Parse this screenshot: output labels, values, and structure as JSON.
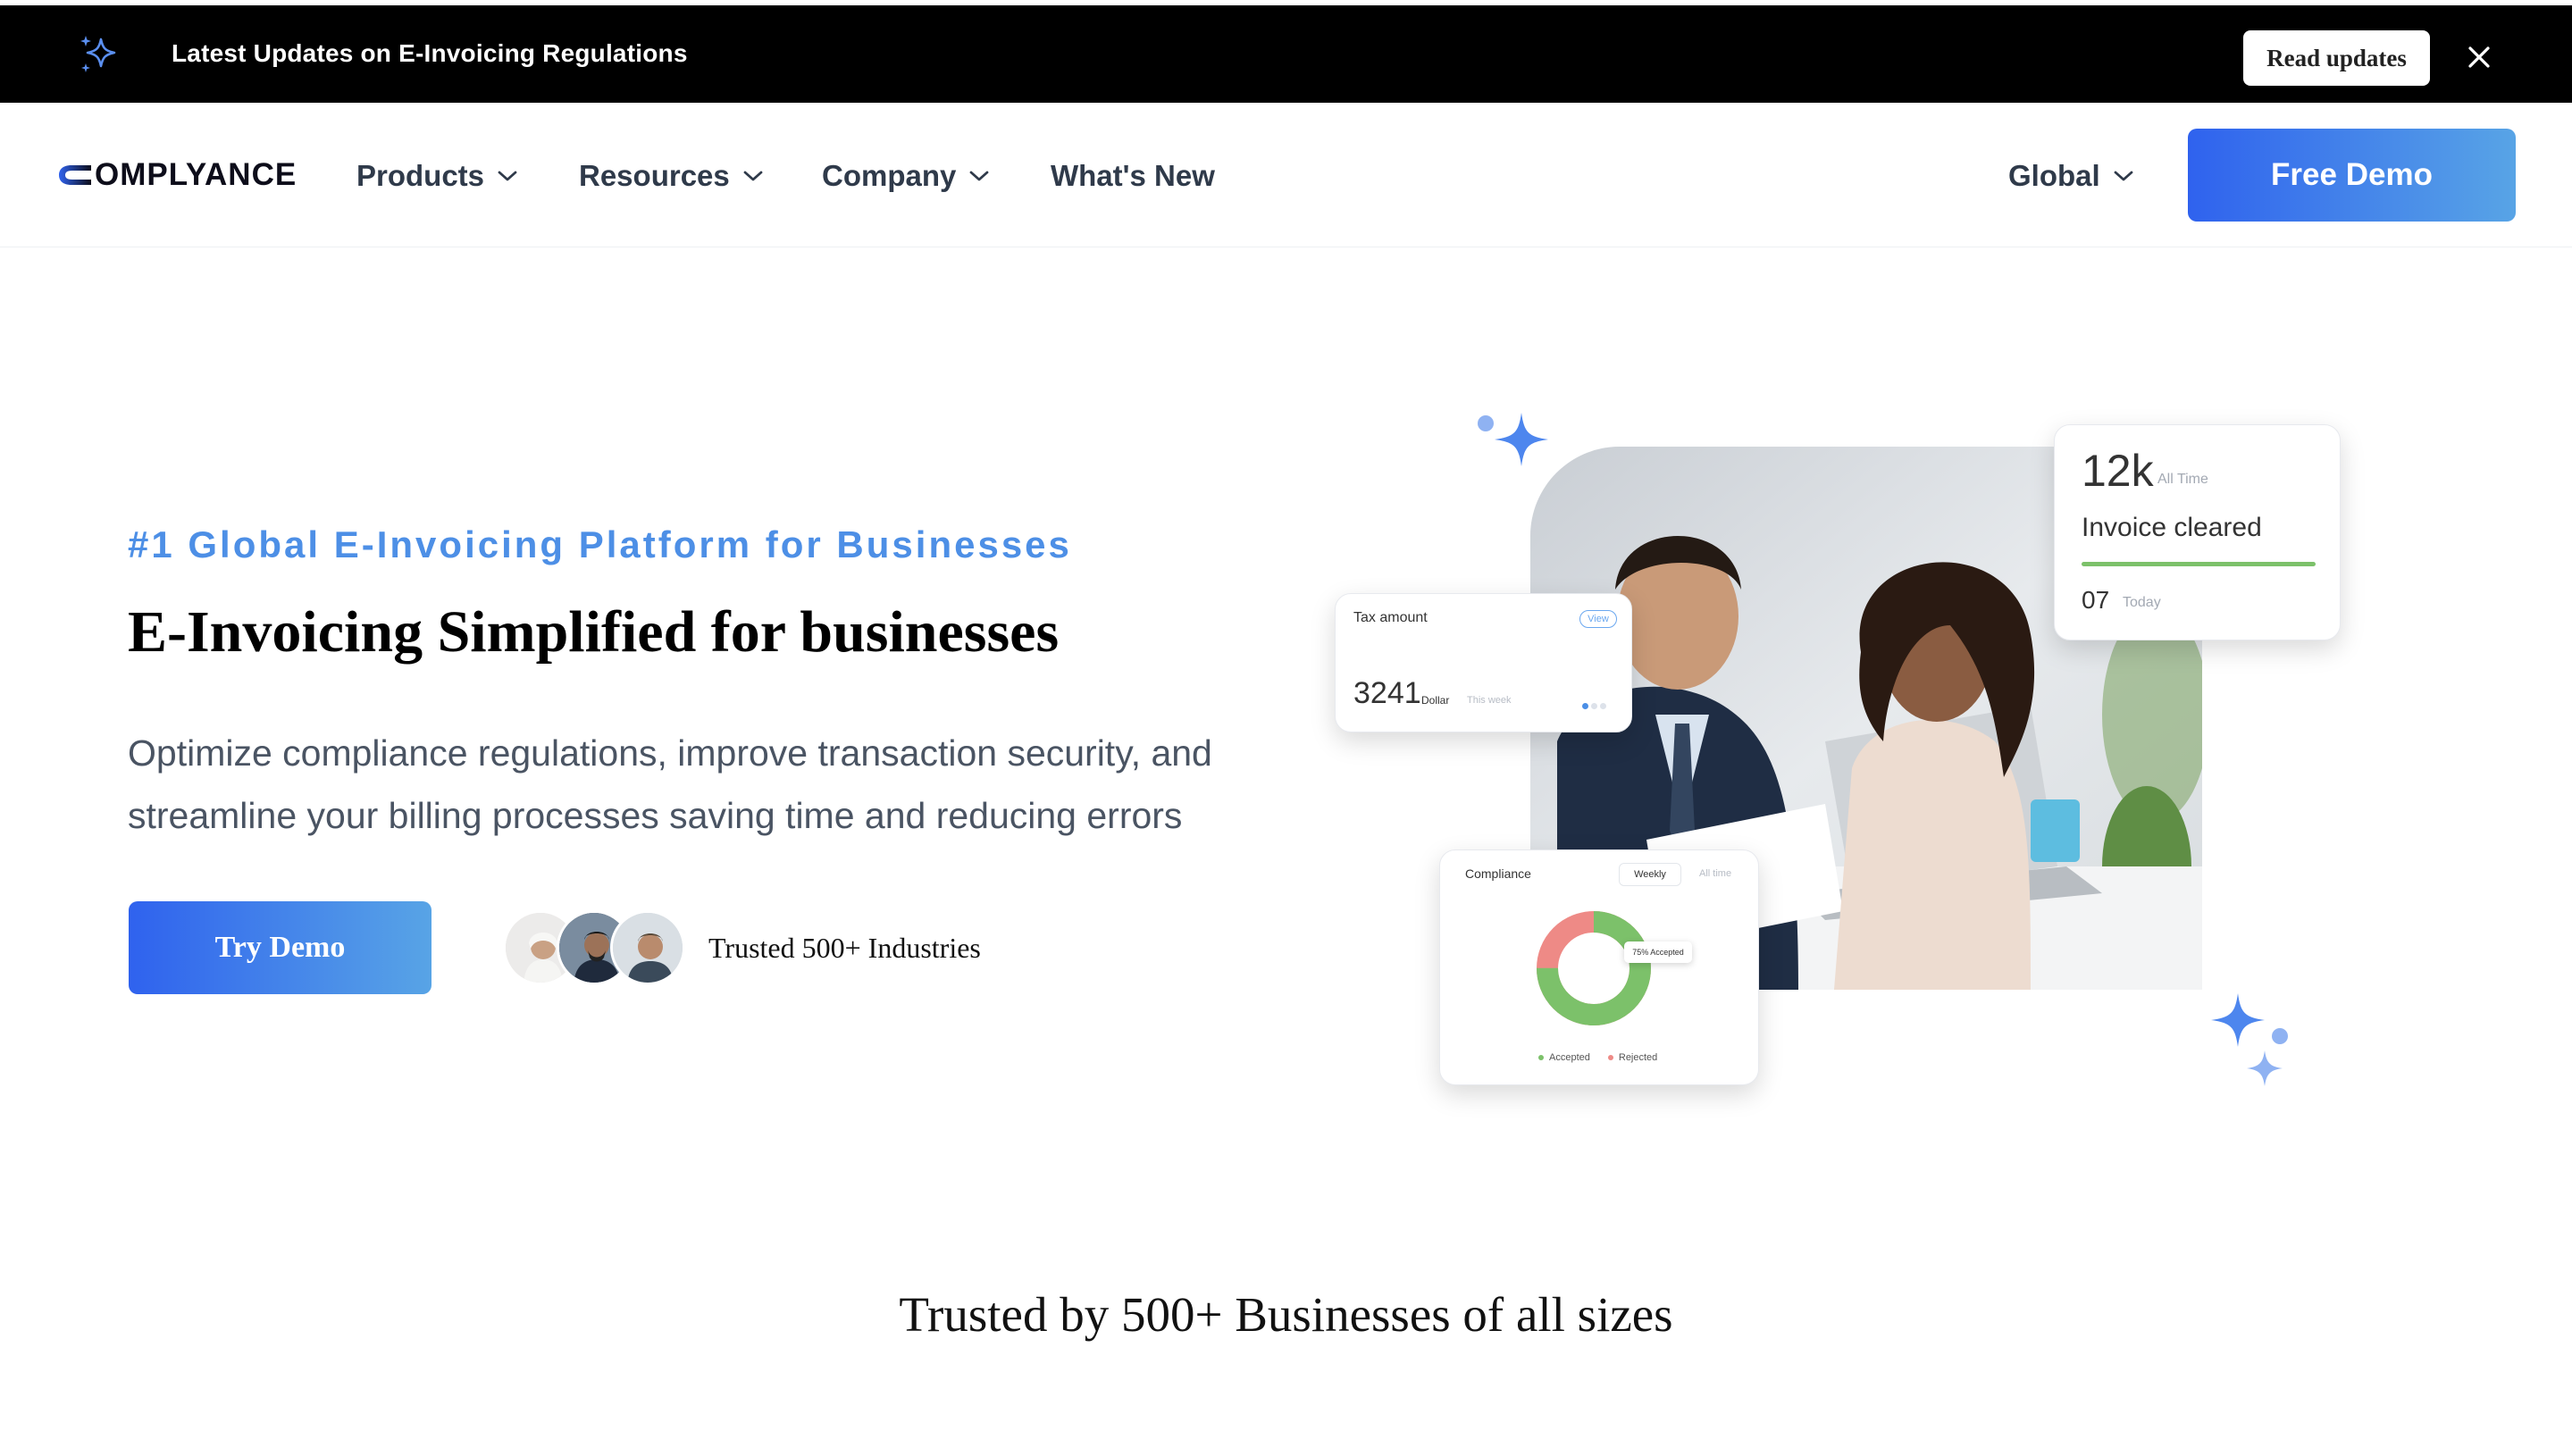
{
  "announcement": {
    "message": "Latest Updates on E-Invoicing Regulations",
    "button_label": "Read updates",
    "icons": [
      "sparkle-icon",
      "close-icon"
    ]
  },
  "nav": {
    "logo_text": "OMPLYANCE",
    "items": [
      {
        "label": "Products",
        "has_dropdown": true
      },
      {
        "label": "Resources",
        "has_dropdown": true
      },
      {
        "label": "Company",
        "has_dropdown": true
      },
      {
        "label": "What's New",
        "has_dropdown": false
      }
    ],
    "region": "Global",
    "cta_label": "Free Demo"
  },
  "hero": {
    "eyebrow": "#1 Global E-Invoicing Platform for Businesses",
    "headline": "E-Invoicing Simplified for businesses",
    "lede": "Optimize compliance regulations, improve transaction security, and streamline your billing processes saving time and reducing errors",
    "cta_label": "Try Demo",
    "trusted_text": "Trusted 500+ Industries"
  },
  "visual": {
    "tax_card": {
      "label": "Tax amount",
      "view_label": "View",
      "amount": "3241",
      "unit": "Dollar",
      "period": "This week"
    },
    "invoice_card": {
      "value": "12k",
      "value_label": "All Time",
      "title": "Invoice cleared",
      "today_value": "07",
      "today_label": "Today"
    },
    "compliance_card": {
      "title": "Compliance",
      "tab_active": "Weekly",
      "tab_inactive": "All time",
      "tooltip": "75% Accepted",
      "accepted_fraction": 0.75,
      "legend": [
        "Accepted",
        "Rejected"
      ]
    }
  },
  "colors": {
    "accent_blue": "#2f62ee",
    "accent_light": "#58a4e6",
    "eyebrow": "#4d8fe6",
    "accepted": "#7cc16a",
    "rejected": "#ee8a86"
  },
  "section": {
    "title": "Trusted by 500+ Businesses of all sizes"
  }
}
